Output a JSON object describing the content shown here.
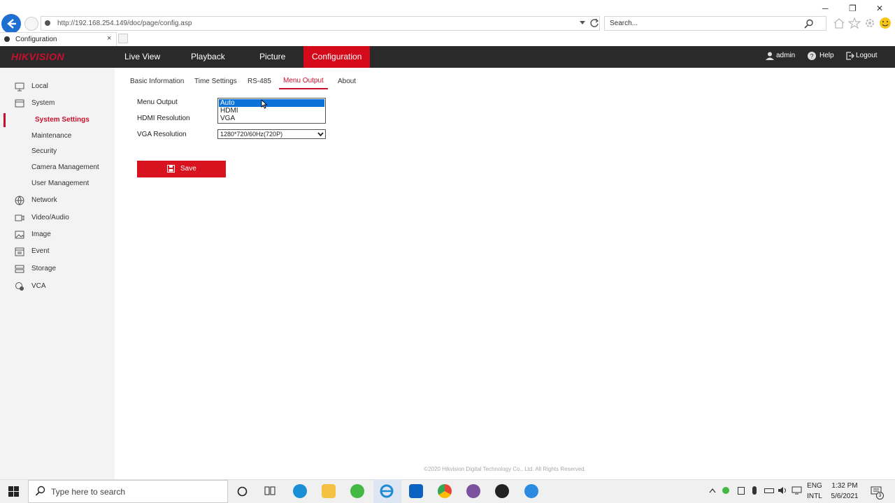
{
  "browser": {
    "url": "http://192.168.254.149/doc/page/config.asp",
    "search_placeholder": "Search...",
    "tab_title": "Configuration",
    "tab_close": "×"
  },
  "app": {
    "logo": "HIKVISION",
    "nav": [
      "Live View",
      "Playback",
      "Picture",
      "Configuration"
    ],
    "user": "admin",
    "help": "Help",
    "logout": "Logout"
  },
  "sidebar": {
    "items": [
      {
        "label": "Local",
        "icon": "monitor-icon"
      },
      {
        "label": "System",
        "icon": "system-icon"
      },
      {
        "label": "System Settings"
      },
      {
        "label": "Maintenance"
      },
      {
        "label": "Security"
      },
      {
        "label": "Camera Management"
      },
      {
        "label": "User Management"
      },
      {
        "label": "Network",
        "icon": "globe-icon"
      },
      {
        "label": "Video/Audio",
        "icon": "video-icon"
      },
      {
        "label": "Image",
        "icon": "image-icon"
      },
      {
        "label": "Event",
        "icon": "calendar-icon"
      },
      {
        "label": "Storage",
        "icon": "storage-icon"
      },
      {
        "label": "VCA",
        "icon": "vca-icon"
      }
    ]
  },
  "subtabs": [
    "Basic Information",
    "Time Settings",
    "RS-485",
    "Menu Output",
    "About"
  ],
  "form": {
    "menu_output_label": "Menu Output",
    "hdmi_resolution_label": "HDMI Resolution",
    "vga_resolution_label": "VGA Resolution",
    "menu_output_options": [
      "Auto",
      "HDMI",
      "VGA"
    ],
    "menu_output_selected": "Auto",
    "vga_resolution_value": "1280*720/60Hz(720P)",
    "save_label": "Save"
  },
  "footer": "©2020 Hikvision Digital Technology Co., Ltd. All Rights Reserved.",
  "taskbar": {
    "search_placeholder": "Type here to search",
    "lang_line1": "ENG",
    "lang_line2": "INTL",
    "time": "1:32 PM",
    "date": "5/6/2021",
    "notification_count": "3"
  },
  "colors": {
    "brand_red": "#d40a1b",
    "header_bg": "#2a2a2a",
    "selection_blue": "#0a72d8"
  }
}
